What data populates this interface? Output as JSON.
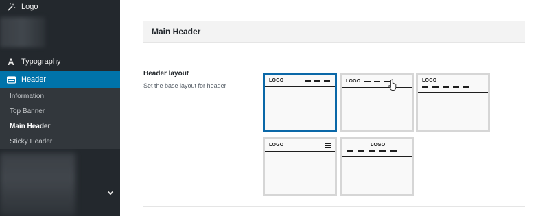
{
  "sidebar": {
    "logo_label": "Logo",
    "typography_label": "Typography",
    "header_label": "Header",
    "submenu": [
      {
        "label": "Information"
      },
      {
        "label": "Top Banner"
      },
      {
        "label": "Main Header"
      },
      {
        "label": "Sticky Header"
      }
    ],
    "current_submenu": "Main Header"
  },
  "main": {
    "section_title": "Main Header",
    "field": {
      "label": "Header layout",
      "description": "Set the base layout for header"
    },
    "layouts": [
      {
        "logo_text": "LOGO",
        "selected": true
      },
      {
        "logo_text": "LOGO",
        "selected": false
      },
      {
        "logo_text": "LOGO",
        "selected": false
      },
      {
        "logo_text": "LOGO",
        "selected": false
      },
      {
        "logo_text": "LOGO",
        "selected": false
      }
    ]
  },
  "colors": {
    "sidebar_bg": "#23282d",
    "submenu_bg": "#32373c",
    "active_bg": "#0073aa",
    "selected_border": "#0b68a8"
  },
  "icons": {
    "logo": "wand-icon",
    "typography": "typography-icon",
    "header": "header-icon",
    "collapse": "chevron-down-icon"
  }
}
